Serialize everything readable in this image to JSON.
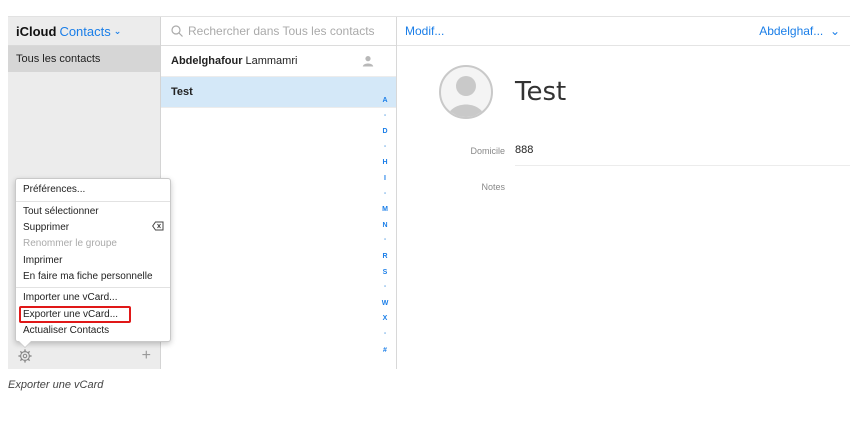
{
  "groups": {
    "brand": "iCloud",
    "app": "Contacts",
    "items": [
      {
        "label": "Tous les contacts"
      }
    ]
  },
  "list": {
    "search_placeholder": "Rechercher dans Tous les contacts",
    "contacts": [
      {
        "first": "Abdelghafour",
        "last": "Lammamri"
      },
      {
        "first": "Test",
        "last": ""
      }
    ],
    "index": [
      "A",
      "•",
      "D",
      "•",
      "H",
      "I",
      "•",
      "M",
      "N",
      "•",
      "R",
      "S",
      "•",
      "W",
      "X",
      "•",
      "#"
    ]
  },
  "detail": {
    "edit_label": "Modif...",
    "account_label": "Abdelghaf...",
    "contact_name": "Test",
    "fields": [
      {
        "label": "Domicile",
        "value": "888"
      },
      {
        "label": "Notes",
        "value": ""
      }
    ]
  },
  "menu": {
    "items": [
      {
        "label": "Préférences...",
        "disabled": false
      },
      {
        "label": "Tout sélectionner",
        "disabled": false
      },
      {
        "label": "Supprimer",
        "disabled": false
      },
      {
        "label": "Renommer le groupe",
        "disabled": true
      },
      {
        "label": "Imprimer",
        "disabled": false
      },
      {
        "label": "En faire ma fiche personnelle",
        "disabled": false
      },
      {
        "label": "Importer une vCard...",
        "disabled": false
      },
      {
        "label": "Exporter une vCard...",
        "disabled": false,
        "highlighted": true
      },
      {
        "label": "Actualiser Contacts",
        "disabled": false
      }
    ]
  },
  "caption": "Exporter une vCard",
  "colors": {
    "accent": "#1a7ee8",
    "highlight": "#e01818",
    "selected_row": "#d4e8f8"
  }
}
